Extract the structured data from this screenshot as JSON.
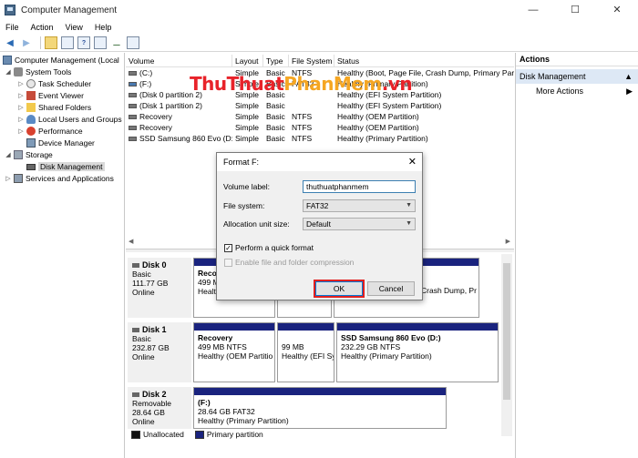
{
  "window": {
    "title": "Computer Management",
    "minimize": "—",
    "maximize": "☐",
    "close": "✕"
  },
  "menu": [
    "File",
    "Action",
    "View",
    "Help"
  ],
  "tree": {
    "root": "Computer Management (Local",
    "system_tools": "System Tools",
    "task_scheduler": "Task Scheduler",
    "event_viewer": "Event Viewer",
    "shared_folders": "Shared Folders",
    "local_users": "Local Users and Groups",
    "performance": "Performance",
    "device_manager": "Device Manager",
    "storage": "Storage",
    "disk_management": "Disk Management",
    "services": "Services and Applications"
  },
  "volumes": {
    "headers": [
      "Volume",
      "Layout",
      "Type",
      "File System",
      "Status"
    ],
    "rows": [
      [
        "(C:)",
        "Simple",
        "Basic",
        "NTFS",
        "Healthy (Boot, Page File, Crash Dump, Primary Part"
      ],
      [
        "(F:)",
        "Simple",
        "Basic",
        "FAT32",
        "Healthy (Primary Partition)"
      ],
      [
        "(Disk 0 partition 2)",
        "Simple",
        "Basic",
        "",
        "Healthy (EFI System Partition)"
      ],
      [
        "(Disk 1 partition 2)",
        "Simple",
        "Basic",
        "",
        "Healthy (EFI System Partition)"
      ],
      [
        "Recovery",
        "Simple",
        "Basic",
        "NTFS",
        "Healthy (OEM Partition)"
      ],
      [
        "Recovery",
        "Simple",
        "Basic",
        "NTFS",
        "Healthy (OEM Partition)"
      ],
      [
        "SSD Samsung 860 Evo (D:)",
        "Simple",
        "Basic",
        "NTFS",
        "Healthy (Primary Partition)"
      ]
    ]
  },
  "disks": {
    "disk0": {
      "name": "Disk 0",
      "type": "Basic",
      "size": "111.77 GB",
      "status": "Online",
      "p1": {
        "l1": "Reco",
        "l2": "499 M",
        "l3": "Healt"
      },
      "p3": {
        "l1": "Crash Dump, Pr"
      }
    },
    "disk1": {
      "name": "Disk 1",
      "type": "Basic",
      "size": "232.87 GB",
      "status": "Online",
      "p1": {
        "l1": "Recovery",
        "l2": "499 MB NTFS",
        "l3": "Healthy (OEM Partitio"
      },
      "p2": {
        "l1": "99 MB",
        "l2": "Healthy (EFI Sy"
      },
      "p3": {
        "l1": "SSD Samsung 860 Evo  (D:)",
        "l2": "232.29 GB NTFS",
        "l3": "Healthy (Primary Partition)"
      }
    },
    "disk2": {
      "name": "Disk 2",
      "type": "Removable",
      "size": "28.64 GB",
      "status": "Online",
      "p1": {
        "l1": "(F:)",
        "l2": "28.64 GB FAT32",
        "l3": "Healthy (Primary Partition)"
      }
    }
  },
  "legend": {
    "unallocated": "Unallocated",
    "primary": "Primary partition"
  },
  "actions": {
    "header": "Actions",
    "section": "Disk Management",
    "more": "More Actions"
  },
  "watermark": {
    "part1": "ThuThuat",
    "part2": "PhanMem",
    "part3": ".vn"
  },
  "dialog": {
    "title": "Format F:",
    "volume_label_caption": "Volume label:",
    "volume_label_value": "thuthuatphanmem",
    "file_system_caption": "File system:",
    "file_system_value": "FAT32",
    "alloc_caption": "Allocation unit size:",
    "alloc_value": "Default",
    "quick_format": "Perform a quick format",
    "compression": "Enable file and folder compression",
    "ok": "OK",
    "cancel": "Cancel"
  },
  "colors": {
    "primary_partition": "#1a237e",
    "ok_highlight": "#e02020",
    "selection": "#d9d9d9"
  }
}
